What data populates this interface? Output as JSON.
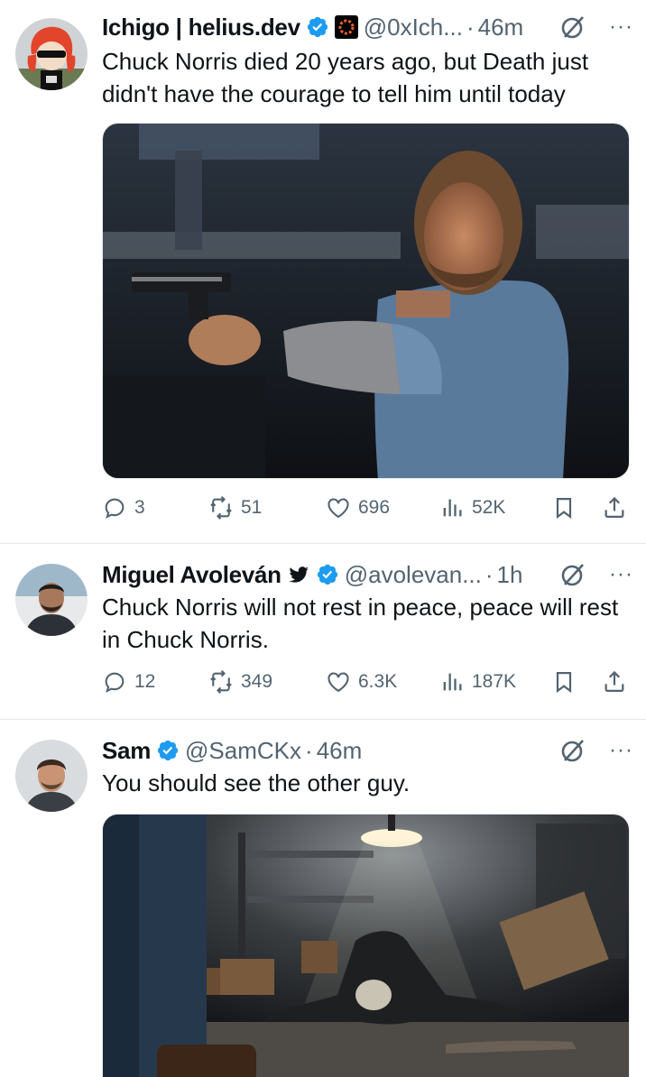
{
  "colors": {
    "accent": "#1d9bf0",
    "muted": "#536471",
    "text": "#0f1419",
    "divider": "#e6e9ec"
  },
  "tweets": [
    {
      "name": "Ichigo | helius.dev",
      "handle": "@0xIch...",
      "sep": "·",
      "time": "46m",
      "text": "Chuck Norris died 20 years ago, but Death just didn't have the courage to tell him until today",
      "replies": "3",
      "reposts": "51",
      "likes": "696",
      "views": "52K",
      "icons": [
        "verified-badge-icon",
        "affiliate-badge-icon",
        "grok-icon",
        "more-icon",
        "reply-icon",
        "repost-icon",
        "like-icon",
        "views-icon",
        "bookmark-icon",
        "share-icon"
      ]
    },
    {
      "name": "Miguel Avoleván",
      "handle": "@avolevan...",
      "sep": "·",
      "time": "1h",
      "text": "Chuck Norris will not rest in peace, peace will rest in Chuck Norris.",
      "replies": "12",
      "reposts": "349",
      "likes": "6.3K",
      "views": "187K",
      "icons": [
        "bird-icon",
        "verified-badge-icon",
        "grok-icon",
        "more-icon"
      ]
    },
    {
      "name": "Sam",
      "handle": "@SamCKx",
      "sep": "·",
      "time": "46m",
      "text": "You should see the other guy.",
      "icons": [
        "verified-badge-icon",
        "grok-icon",
        "more-icon"
      ]
    }
  ],
  "more_glyph": "···"
}
